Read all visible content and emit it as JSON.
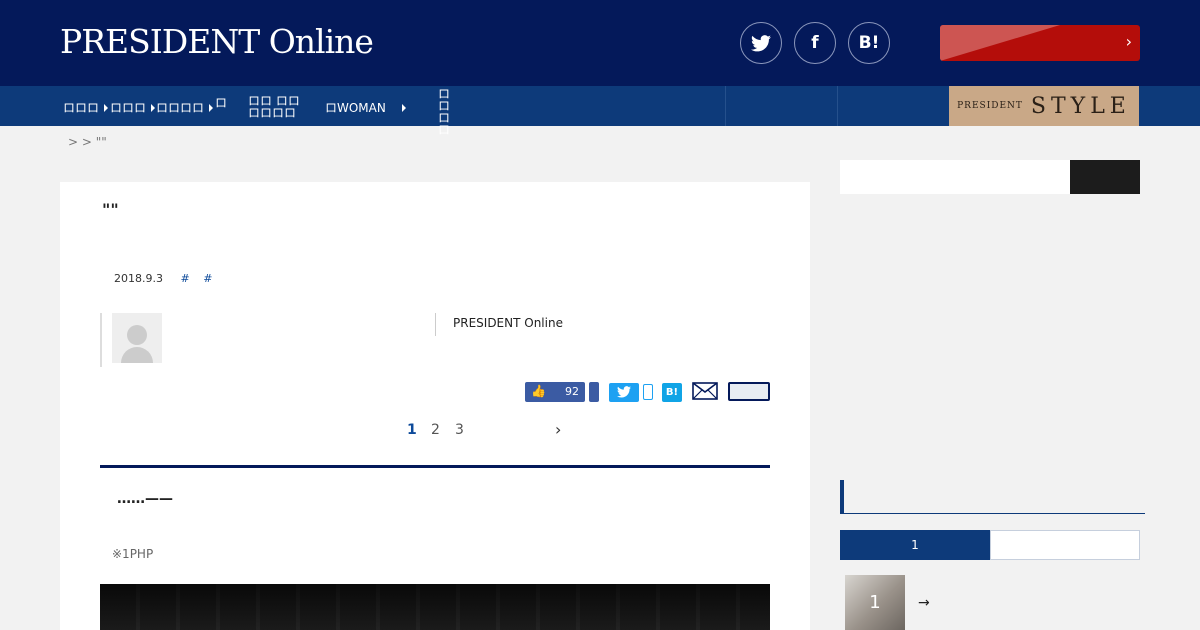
{
  "header": {
    "logo": "PRESIDENT Online",
    "social": [
      {
        "icon": "twitter-icon",
        "glyph": "🐦"
      },
      {
        "icon": "facebook-icon",
        "glyph": "f"
      },
      {
        "icon": "hatena-bookmark-icon",
        "glyph": "B!"
      }
    ],
    "signup_chevron": "›"
  },
  "nav": {
    "items": [
      "ロロロ",
      "ロロロ",
      "ロロロロ",
      "ロ",
      "ロロ ロロロロロロ",
      "ロWOMAN",
      "ロロ ロロ"
    ],
    "style_banner": {
      "small": "PRESIDENT",
      "big": "STYLE"
    }
  },
  "breadcrumb": ">    >  \"\"",
  "article": {
    "title": "\"\"",
    "date": "2018.9.3",
    "tags": [
      "#",
      "#"
    ],
    "publisher": "PRESIDENT Online",
    "like_count": "92",
    "pages": [
      "1",
      "2",
      "3"
    ],
    "next": "›",
    "lead": "……——",
    "note": "※1PHP"
  },
  "sidebar": {
    "ranking_tab_active": "1",
    "ranking_item_rank": "1",
    "ranking_item_arrow": "→"
  },
  "colors": {
    "header_bg": "#04195a",
    "nav_bg": "#0d3a7a",
    "signup_red": "#b40d0a",
    "style_gold": "#c9a887"
  }
}
